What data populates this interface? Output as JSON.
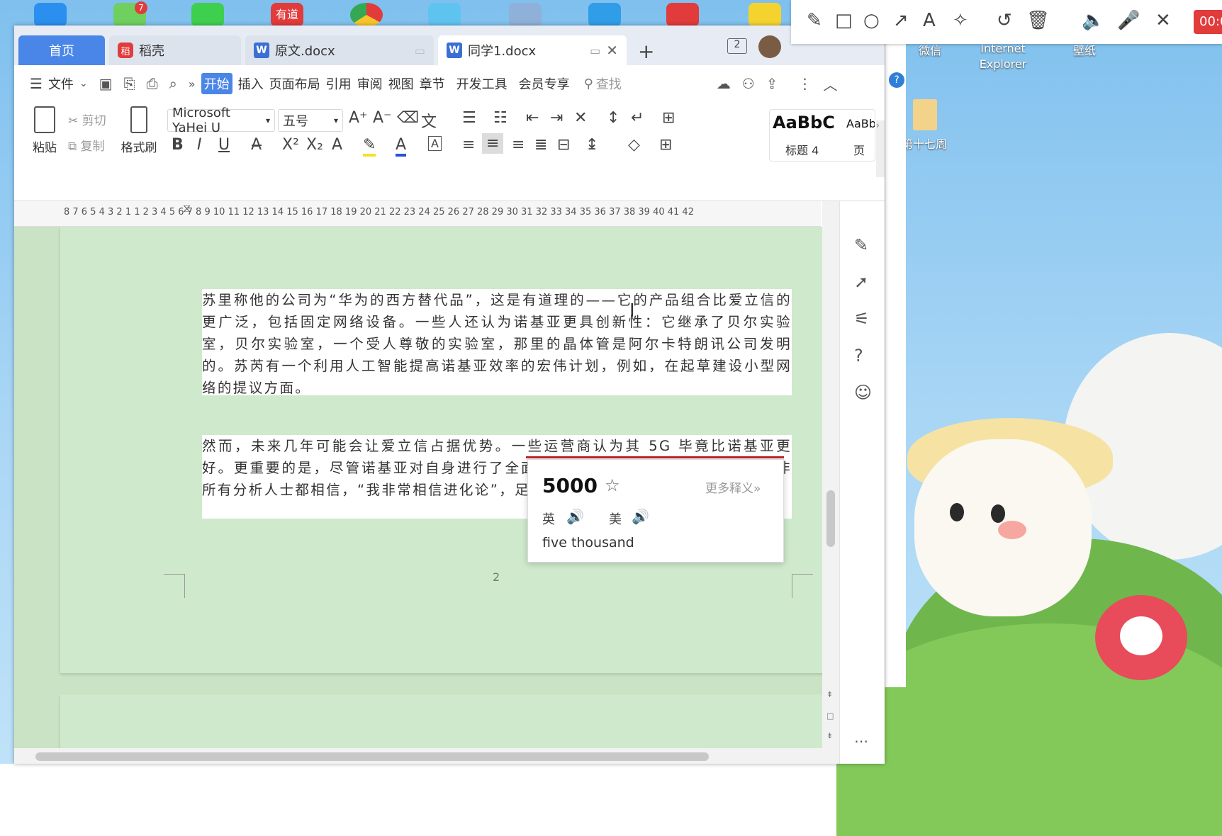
{
  "desktop": {
    "icons": [
      {
        "label": "微信"
      },
      {
        "label": "Internet\nExplorer"
      },
      {
        "label": "壁纸"
      },
      {
        "label": "第十七周"
      }
    ],
    "taskbar_badge": "7",
    "youdao_label": "有道"
  },
  "tabs": {
    "home": "首页",
    "daoke": "稻壳",
    "doc1": "原文.docx",
    "doc2": "同学1.docx",
    "count_badge": "2"
  },
  "menu": {
    "file": "文件",
    "items": [
      "开始",
      "插入",
      "页面布局",
      "引用",
      "审阅",
      "视图",
      "章节",
      "开发工具",
      "会员专享"
    ],
    "search_placeholder": "查找"
  },
  "ribbon": {
    "paste": "粘贴",
    "cut": "剪切",
    "copy": "复制",
    "format_painter": "格式刷",
    "font_name": "Microsoft YaHei U",
    "font_size": "五号",
    "style_preview": "AaBbC",
    "style_preview2": "AaBb(",
    "style_name": "标题 4",
    "style_name2": "页"
  },
  "ruler": {
    "numbers": "8 7 6 5 4 3 2 1   1 2 3 4 5 6 7 8 9 10 11 12 13 14 15 16 17 18 19 20 21 22 23 24 25 26 27 28 29 30 31 32 33 34 35 36 37 38 39 40 41 42"
  },
  "document": {
    "paragraph1": "苏里称他的公司为“华为的西方替代品”，这是有道理的——它的产品组合比爱立信的更广泛，包括固定网络设备。一些人还认为诺基亚更具创新性：它继承了贝尔实验室，贝尔实验室，一个受人尊敬的实验室，那里的晶体管是阿尔卡特朗讯公司发明的。苏芮有一个利用人工智能提高诺基亚效率的宏伟计划，例如，在起草建设小型网络的提议方面。",
    "paragraph2": "然而，未来几年可能会让爱立信占据优势。一些运营商认为其 5G 毕竟比诺基亚更好。更重要的是，尽管诺基亚对自身进行了全面改革，它的计划看起来很严肃。并非所有分析人士都相信，“我非常相信进化论”，足以改变爱立信。但该公司",
    "page_number": "2"
  },
  "dictionary_popup": {
    "word": "5000",
    "more": "更多释义»",
    "uk": "英",
    "us": "美",
    "meaning": "five thousand"
  },
  "annotation_toolbar": {
    "timer": "00:0"
  }
}
